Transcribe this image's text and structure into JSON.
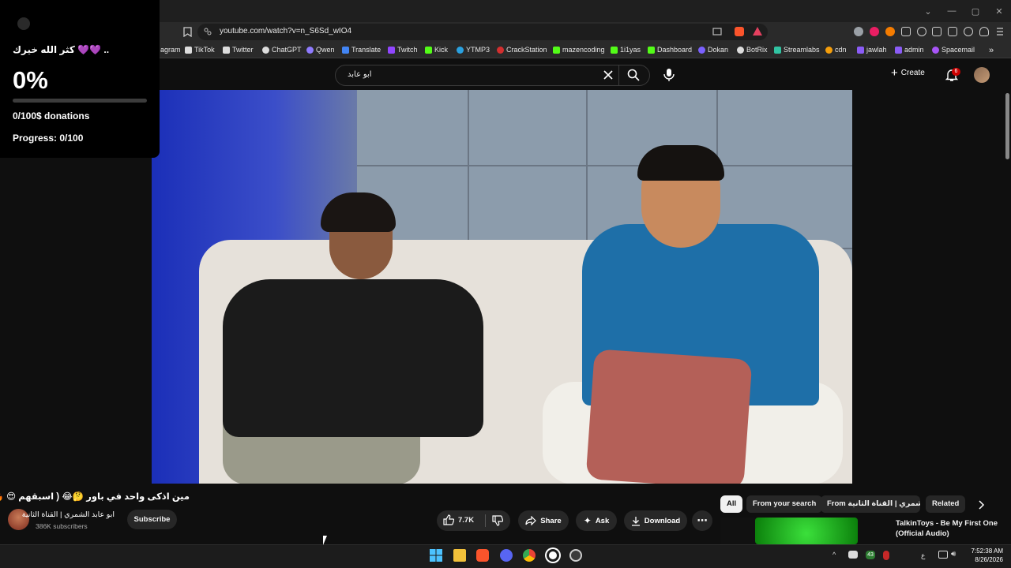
{
  "browser": {
    "url": "youtube.com/watch?v=n_S6Sd_wIO4",
    "bookmarks": [
      {
        "label": "agram",
        "color": "#c13584"
      },
      {
        "label": "TikTok",
        "color": "#ffffff"
      },
      {
        "label": "Twitter",
        "color": "#1d9bf0"
      },
      {
        "label": "ChatGPT",
        "color": "#ffffff"
      },
      {
        "label": "Qwen",
        "color": "#8f7bff"
      },
      {
        "label": "Translate",
        "color": "#4285f4"
      },
      {
        "label": "Twitch",
        "color": "#9146ff"
      },
      {
        "label": "Kick",
        "color": "#53fc18"
      },
      {
        "label": "YTMP3",
        "color": "#2aa1e0"
      },
      {
        "label": "CrackStation",
        "color": "#d32f2f"
      },
      {
        "label": "mazencoding",
        "color": "#53fc18"
      },
      {
        "label": "1i1yas",
        "color": "#53fc18"
      },
      {
        "label": "Dashboard",
        "color": "#53fc18"
      },
      {
        "label": "Dokan",
        "color": "#7b61ff"
      },
      {
        "label": "BotRix",
        "color": "#ffffff"
      },
      {
        "label": "Streamlabs",
        "color": "#31c3a2"
      },
      {
        "label": "cdn",
        "color": "#f59e0b"
      },
      {
        "label": "jawlah",
        "color": "#8b5cf6"
      },
      {
        "label": "admin",
        "color": "#8b5cf6"
      },
      {
        "label": "Spacemail",
        "color": "#a855f7"
      }
    ]
  },
  "donation_widget": {
    "title": "كثر الله خيرك 💜💜 ..",
    "percent": "0%",
    "progress_fraction": 0,
    "amount": "0/100$ donations",
    "progress": "Progress: 0/100"
  },
  "youtube": {
    "search_value": "ابو عابد",
    "create_label": "Create",
    "notification_count": "6",
    "video_title": "مين اذكى واحد في باور 🤔😂 ( اسبقهم 😍 🔥 )",
    "channel_name": "ابو عابد الشمري | القناة الثانية",
    "subscribers": "386K subscribers",
    "subscribe_label": "Subscribe",
    "like_count": "7.7K",
    "share_label": "Share",
    "ask_label": "Ask",
    "download_label": "Download",
    "chips": [
      "All",
      "From your search",
      "From ابو عابد الشمري | القناة الثانية",
      "Related"
    ],
    "recommendation_title": "TalkinToys - Be My First One (Official Audio)"
  },
  "taskbar": {
    "time": "7:52:38 AM",
    "date": "8/26/2026",
    "tray_badge": "43"
  }
}
